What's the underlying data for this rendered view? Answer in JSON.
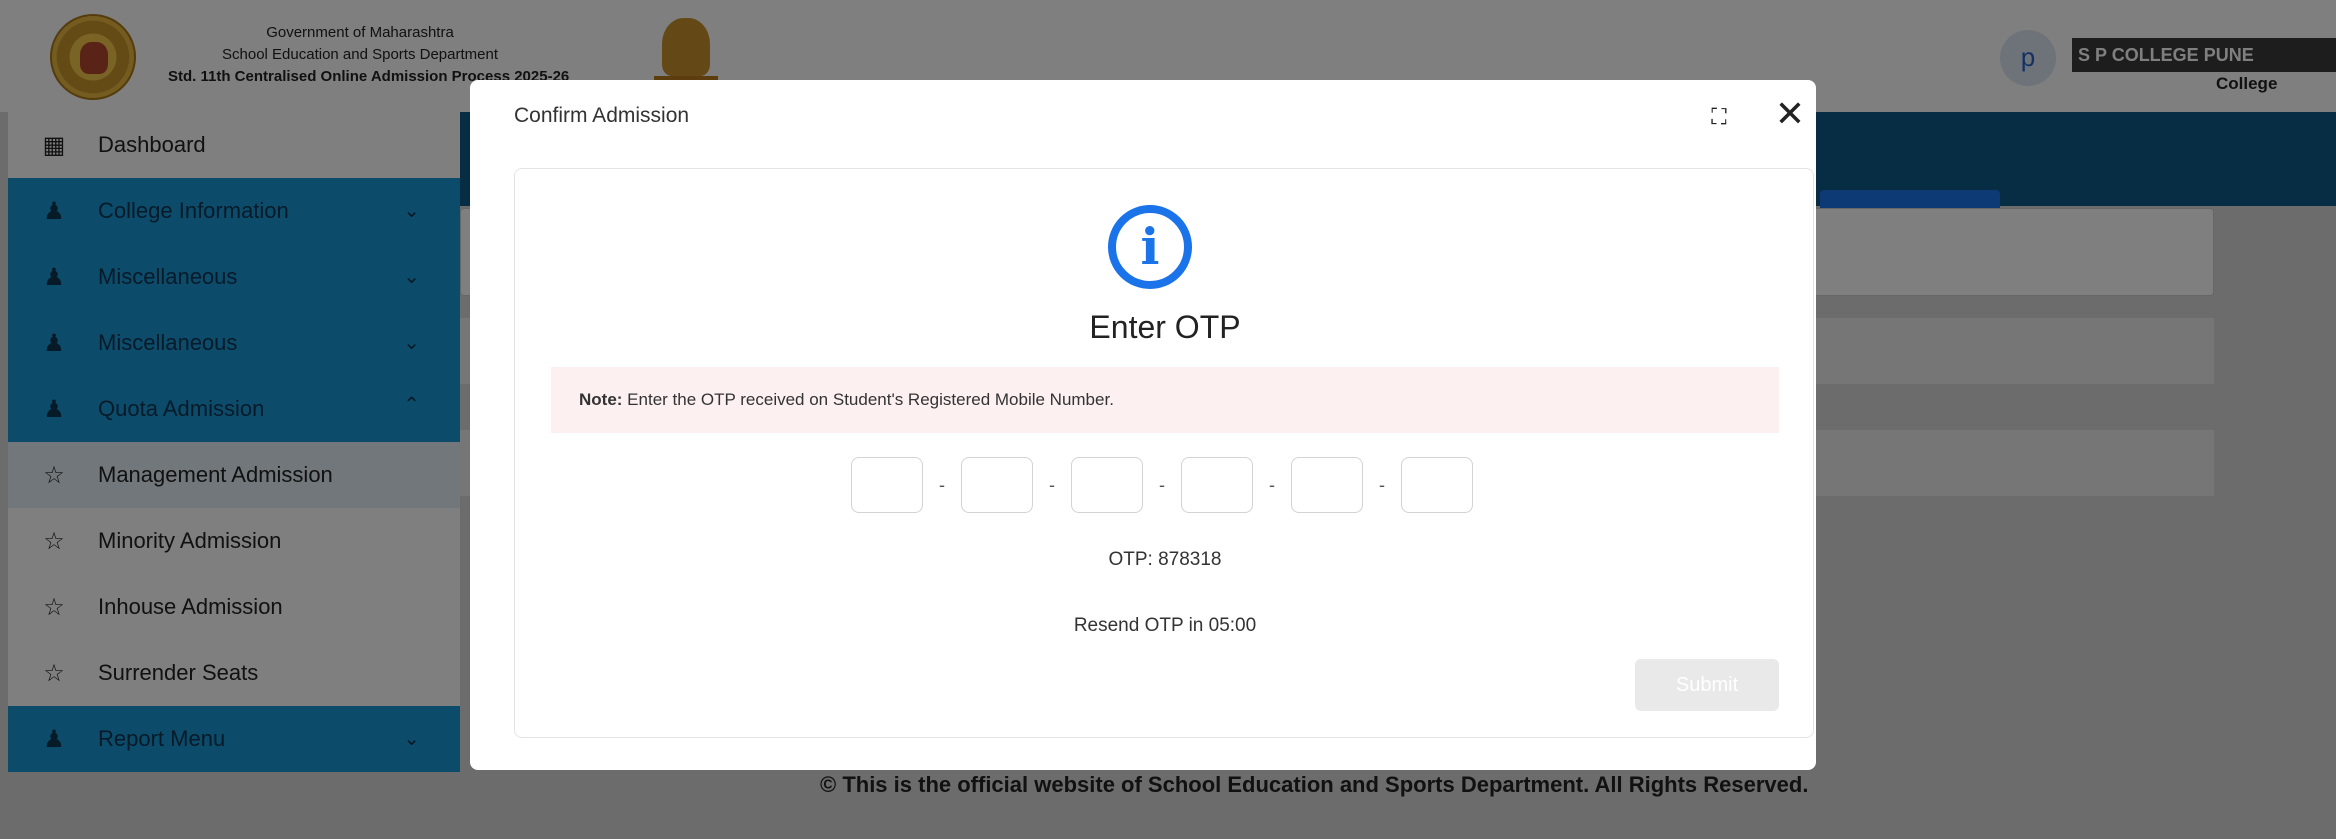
{
  "header": {
    "gov_line1": "Government of Maharashtra",
    "gov_line2": "School Education and Sports Department",
    "gov_line3": "Std. 11th Centralised Online Admission Process 2025-26",
    "avatar_letter": "p",
    "user_name": "S P COLLEGE PUNE",
    "user_role": "College"
  },
  "sidebar": {
    "items": [
      {
        "label": "Dashboard",
        "icon": "grid-icon"
      },
      {
        "label": "College Information",
        "icon": "users-icon"
      },
      {
        "label": "Miscellaneous",
        "icon": "users-icon"
      },
      {
        "label": "Miscellaneous",
        "icon": "users-icon"
      },
      {
        "label": "Quota Admission",
        "icon": "users-icon"
      },
      {
        "label": "Management Admission",
        "icon": "star-icon"
      },
      {
        "label": "Minority Admission",
        "icon": "star-icon"
      },
      {
        "label": "Inhouse Admission",
        "icon": "star-icon"
      },
      {
        "label": "Surrender Seats",
        "icon": "star-icon"
      },
      {
        "label": "Report Menu",
        "icon": "users-icon"
      }
    ]
  },
  "footer": {
    "text": "© This is the official website of School Education and Sports Department. All Rights Reserved."
  },
  "modal": {
    "title": "Confirm Admission",
    "heading": "Enter OTP",
    "note_label": "Note:",
    "note_text": " Enter the OTP received on Student's Registered Mobile Number.",
    "otp_separator": "-",
    "otp_display": "OTP: 878318",
    "resend_text": "Resend OTP in 05:00",
    "submit_label": "Submit"
  },
  "colors": {
    "accent": "#1a73e8",
    "sidebar_blue": "#1a96d6",
    "note_bg": "#fdf0f0"
  }
}
